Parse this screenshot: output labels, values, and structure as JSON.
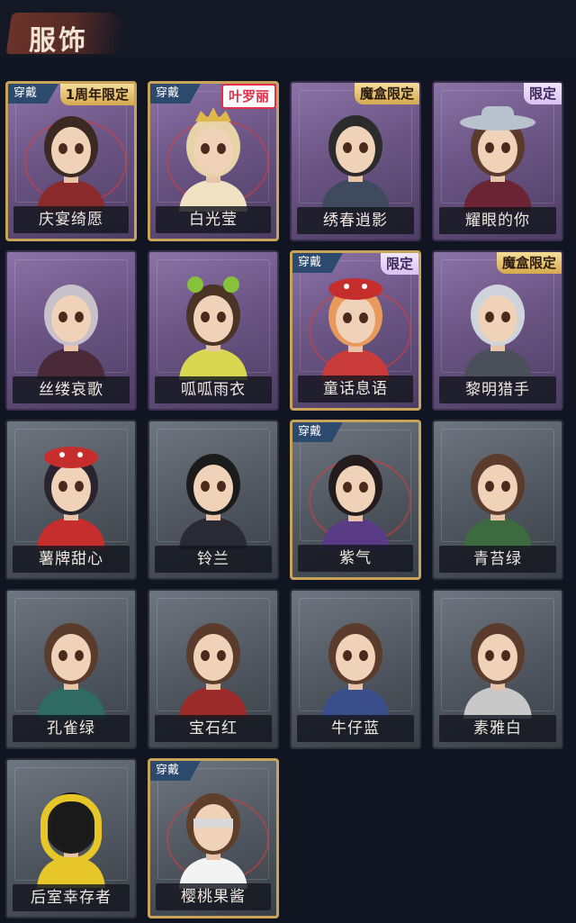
{
  "header": {
    "title": "服饰"
  },
  "labels": {
    "equipped": "穿戴"
  },
  "colors": {
    "background": "#111521",
    "rare_card": "#6b5585",
    "common_card": "#515861",
    "equipped_frame": "#c7a45a"
  },
  "costumes": [
    {
      "name": "庆宴绮愿",
      "tag": "1周年限定",
      "equipped": true,
      "style": "purple",
      "art": "birthday-cake-portrait"
    },
    {
      "name": "白光莹",
      "tag": "叶罗丽",
      "equipped": true,
      "style": "purple",
      "art": "crown-portrait"
    },
    {
      "name": "绣春逍影",
      "tag": "魔盒限定",
      "equipped": false,
      "style": "purple",
      "art": "swordsman-portrait"
    },
    {
      "name": "耀眼的你",
      "tag": "限定",
      "equipped": false,
      "style": "purple",
      "art": "cowboy-hat-portrait"
    },
    {
      "name": "丝缕哀歌",
      "tag": "",
      "equipped": false,
      "style": "purple",
      "art": "lace-veil-portrait"
    },
    {
      "name": "呱呱雨衣",
      "tag": "",
      "equipped": false,
      "style": "purple",
      "art": "frog-hat-portrait"
    },
    {
      "name": "童话息语",
      "tag": "限定",
      "equipped": true,
      "style": "purple",
      "art": "mushroom-cap-portrait"
    },
    {
      "name": "黎明猎手",
      "tag": "魔盒限定",
      "equipped": false,
      "style": "purple",
      "art": "hunter-portrait"
    },
    {
      "name": "薯牌甜心",
      "tag": "",
      "equipped": false,
      "style": "gray",
      "art": "mushroom-hat-portrait"
    },
    {
      "name": "铃兰",
      "tag": "",
      "equipped": false,
      "style": "gray",
      "art": "dark-hair-portrait"
    },
    {
      "name": "紫气",
      "tag": "",
      "equipped": true,
      "style": "gray",
      "art": "braid-portrait"
    },
    {
      "name": "青苔绿",
      "tag": "",
      "equipped": false,
      "style": "gray",
      "art": "green-outfit-portrait"
    },
    {
      "name": "孔雀绿",
      "tag": "",
      "equipped": false,
      "style": "gray",
      "art": "teal-outfit-portrait"
    },
    {
      "name": "宝石红",
      "tag": "",
      "equipped": false,
      "style": "gray",
      "art": "red-outfit-portrait"
    },
    {
      "name": "牛仔蓝",
      "tag": "",
      "equipped": false,
      "style": "gray",
      "art": "blue-outfit-portrait"
    },
    {
      "name": "素雅白",
      "tag": "",
      "equipped": false,
      "style": "gray",
      "art": "white-outfit-portrait"
    },
    {
      "name": "后室幸存者",
      "tag": "",
      "equipped": false,
      "style": "gray",
      "art": "gas-mask-portrait"
    },
    {
      "name": "樱桃果酱",
      "tag": "",
      "equipped": true,
      "style": "gray",
      "art": "blindfold-portrait"
    }
  ]
}
